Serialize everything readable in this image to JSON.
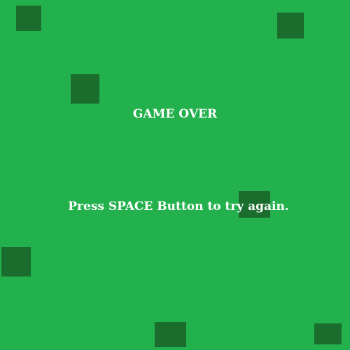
{
  "screen": {
    "title": "GAME OVER",
    "instructions": "Press SPACE Button to try again."
  },
  "colors": {
    "background": "#23b14d",
    "block": "#1a6d2c",
    "text": "#ffffff"
  }
}
